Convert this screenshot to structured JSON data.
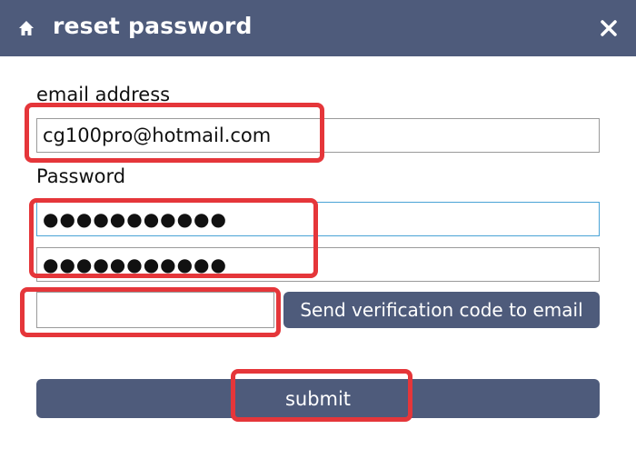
{
  "window": {
    "title": "reset password",
    "icon": "home-icon",
    "close_icon": "close-icon"
  },
  "form": {
    "email_label": "email address",
    "email_value": "cg100pro@hotmail.com",
    "password_label": "Password",
    "password_value": "●●●●●●●●●●●",
    "confirm_password_value": "●●●●●●●●●●●",
    "verification_code_value": "",
    "send_code_label": "Send verification code to email",
    "submit_label": "submit"
  },
  "colors": {
    "titlebar": "#4e5b7b",
    "button": "#4e5b7b",
    "highlight": "#e5363a",
    "focus_border": "#49a3d6"
  }
}
